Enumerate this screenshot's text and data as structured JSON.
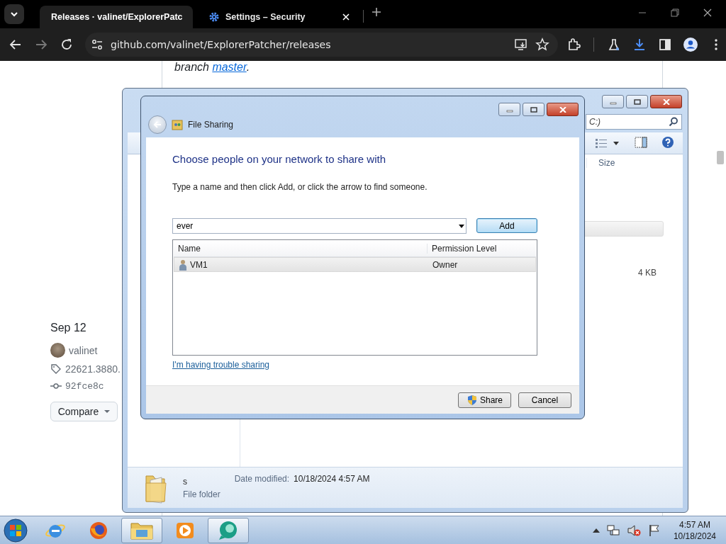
{
  "browser": {
    "tabs": [
      {
        "title": "Releases · valinet/ExplorerPatc",
        "kind": "page",
        "selected": true
      },
      {
        "title": "Settings – Security",
        "kind": "settings",
        "selected": false
      }
    ],
    "address": "github.com/valinet/ExplorerPatcher/releases"
  },
  "github": {
    "sentence_start": "branch",
    "link": "master",
    "sentence_end": ".",
    "release": {
      "date": "Sep 12",
      "author": "valinet",
      "tag": "22621.3880.",
      "commit": "92fce8c",
      "compare_button": "Compare"
    }
  },
  "explorer": {
    "search_placeholder": "C:)",
    "columns": [
      "Size"
    ],
    "file_size": "4 KB",
    "details": {
      "name": "s",
      "type": "File folder",
      "date_label": "Date modified:",
      "date": "10/18/2024 4:57 AM"
    }
  },
  "dialog": {
    "title": "File Sharing",
    "heading": "Choose people on your network to share with",
    "instruction": "Type a name and then click Add, or click the arrow to find someone.",
    "name_field": {
      "value": "ever"
    },
    "add_button": "Add",
    "list": {
      "columns": [
        "Name",
        "Permission Level"
      ],
      "rows": [
        {
          "name": "VM1",
          "permission": "Owner",
          "selected": true
        }
      ]
    },
    "help_link": "I'm having trouble sharing",
    "buttons": [
      "Share",
      "Cancel"
    ]
  },
  "taskbar": {
    "apps": [
      {
        "kind": "ie",
        "active": false
      },
      {
        "kind": "firefox",
        "active": false
      },
      {
        "kind": "explorer",
        "active": true
      },
      {
        "kind": "media",
        "active": false
      },
      {
        "kind": "chat",
        "active": true
      }
    ],
    "clock": {
      "time": "4:57 AM",
      "date": "10/18/2024"
    }
  }
}
